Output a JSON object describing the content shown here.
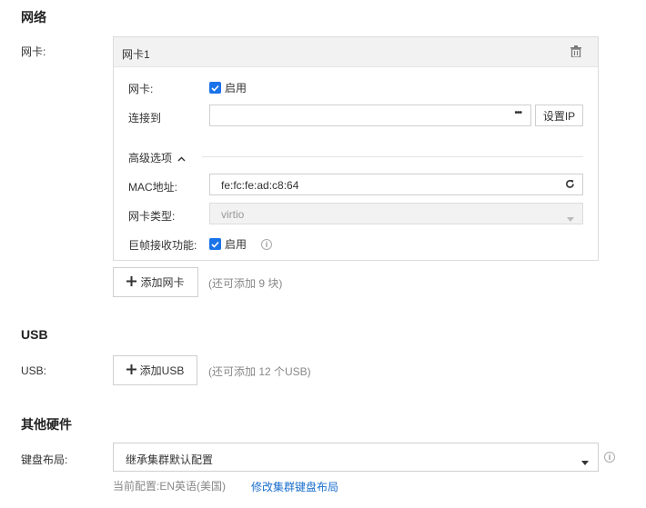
{
  "network": {
    "section_title": "网络",
    "nic_label": "网卡:",
    "card": {
      "title": "网卡1",
      "enable_row_label": "网卡:",
      "enable_text": "启用",
      "connect_label": "连接到",
      "connect_value": "",
      "more_glyph": "•••",
      "set_ip_label": "设置IP",
      "advanced_label": "高级选项",
      "mac_label": "MAC地址:",
      "mac_value": "fe:fc:fe:ad:c8:64",
      "nic_type_label": "网卡类型:",
      "nic_type_value": "virtio",
      "jumbo_label": "巨帧接收功能:",
      "jumbo_text": "启用"
    },
    "add_nic_label": "添加网卡",
    "add_nic_hint": "(还可添加 9 块)"
  },
  "usb": {
    "section_title": "USB",
    "usb_label": "USB:",
    "add_usb_label": "添加USB",
    "add_usb_hint": "(还可添加 12 个USB)"
  },
  "other": {
    "section_title": "其他硬件",
    "keyboard_label": "键盘布局:",
    "keyboard_value": "继承集群默认配置",
    "current_config": "当前配置:EN英语(美国)",
    "modify_link": "修改集群键盘布局"
  }
}
